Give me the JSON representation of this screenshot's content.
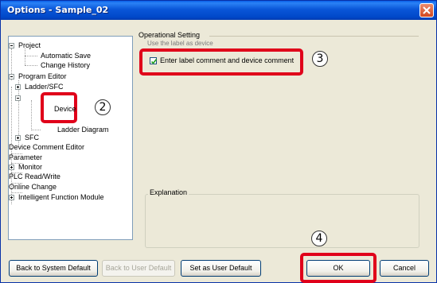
{
  "window": {
    "title": "Options - Sample_02"
  },
  "tree": {
    "items": [
      {
        "label": "Project"
      },
      {
        "label": "Automatic Save"
      },
      {
        "label": "Change History"
      },
      {
        "label": "Program Editor"
      },
      {
        "label": "Ladder/SFC"
      },
      {
        "label": "Device"
      },
      {
        "label": "Ladder Diagram"
      },
      {
        "label": "SFC"
      },
      {
        "label": "Device Comment Editor"
      },
      {
        "label": "Parameter"
      },
      {
        "label": "Monitor"
      },
      {
        "label": "PLC Read/Write"
      },
      {
        "label": "Online Change"
      },
      {
        "label": "Intelligent Function Module"
      }
    ]
  },
  "settings": {
    "group_label": "Operational Setting",
    "partial_row": "Use the label as device",
    "checkbox_label": "Enter label comment and device comment",
    "checkbox_checked": true,
    "explanation_label": "Explanation"
  },
  "callouts": {
    "c2": "2",
    "c3": "3",
    "c4": "4"
  },
  "buttons": {
    "back_system": "Back to System Default",
    "back_user": "Back to User Default",
    "set_user": "Set as User Default",
    "ok": "OK",
    "cancel": "Cancel"
  },
  "colors": {
    "highlight": "#e0001a",
    "titlebar": "#0a56d8"
  }
}
